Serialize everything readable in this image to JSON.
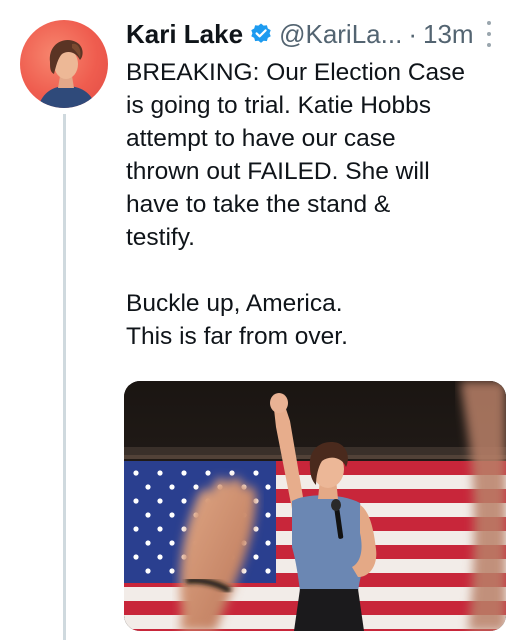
{
  "tweet": {
    "author": {
      "display_name": "Kari Lake",
      "handle": "@KariLa...",
      "verified": true,
      "verified_color": "#1d9bf0"
    },
    "separator": "·",
    "timestamp": "13m",
    "body_lines": [
      "BREAKING: Our Election Case",
      "is going to trial. Katie Hobbs",
      "attempt to have our case",
      "thrown out FAILED. She will",
      "have to take the stand &",
      "testify.",
      "",
      "Buckle up, America.",
      "This is far from over."
    ],
    "media": {
      "kind": "photo",
      "subject": "woman-speaking-on-stage-icon"
    },
    "icons": [
      "verified-badge-icon",
      "more-options-icon",
      "avatar"
    ]
  },
  "colors": {
    "text": "#0f1419",
    "secondary_text": "#536471",
    "thread_line": "#cfd9de",
    "avatar_bg": "#ef5d4f"
  }
}
